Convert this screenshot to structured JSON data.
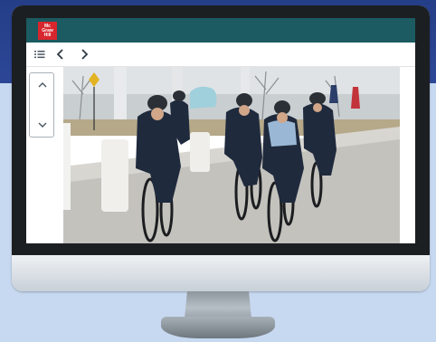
{
  "app": {
    "logo_lines": [
      "Mc",
      "Graw",
      "Hill"
    ],
    "brand_color": "#d8262e",
    "header_color": "#1b5b61"
  },
  "toolbar": {
    "icons": [
      "list-icon",
      "chevron-left-icon",
      "chevron-right-icon"
    ]
  },
  "sidebar": {
    "icons": [
      "chevron-up-icon",
      "chevron-down-icon"
    ]
  },
  "photo": {
    "subject": "police-officers-on-bicycles"
  }
}
